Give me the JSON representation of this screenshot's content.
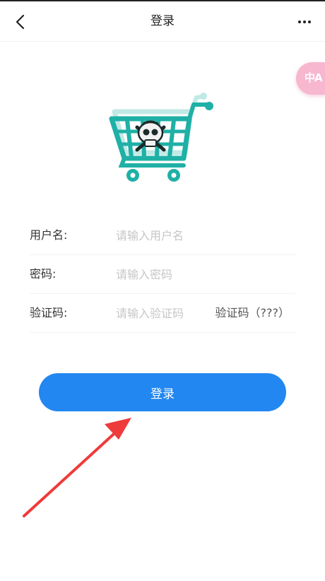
{
  "header": {
    "title": "登录"
  },
  "translate": {
    "label": "中A"
  },
  "form": {
    "username_label": "用户名:",
    "username_placeholder": "请输入用户名",
    "password_label": "密码:",
    "password_placeholder": "请输入密码",
    "captcha_label": "验证码:",
    "captcha_placeholder": "请输入验证码",
    "captcha_text": "验证码（???）"
  },
  "login_button": {
    "label": "登录"
  },
  "colors": {
    "primary": "#2287f0",
    "annotation_arrow": "#ee3b3b",
    "cart_teal": "#1fb0a6",
    "translate_pink": "#f7b7cf"
  },
  "icons": [
    "back-arrow-icon",
    "more-dots-icon",
    "translate-icon",
    "shopping-cart-logo",
    "skull-icon"
  ]
}
